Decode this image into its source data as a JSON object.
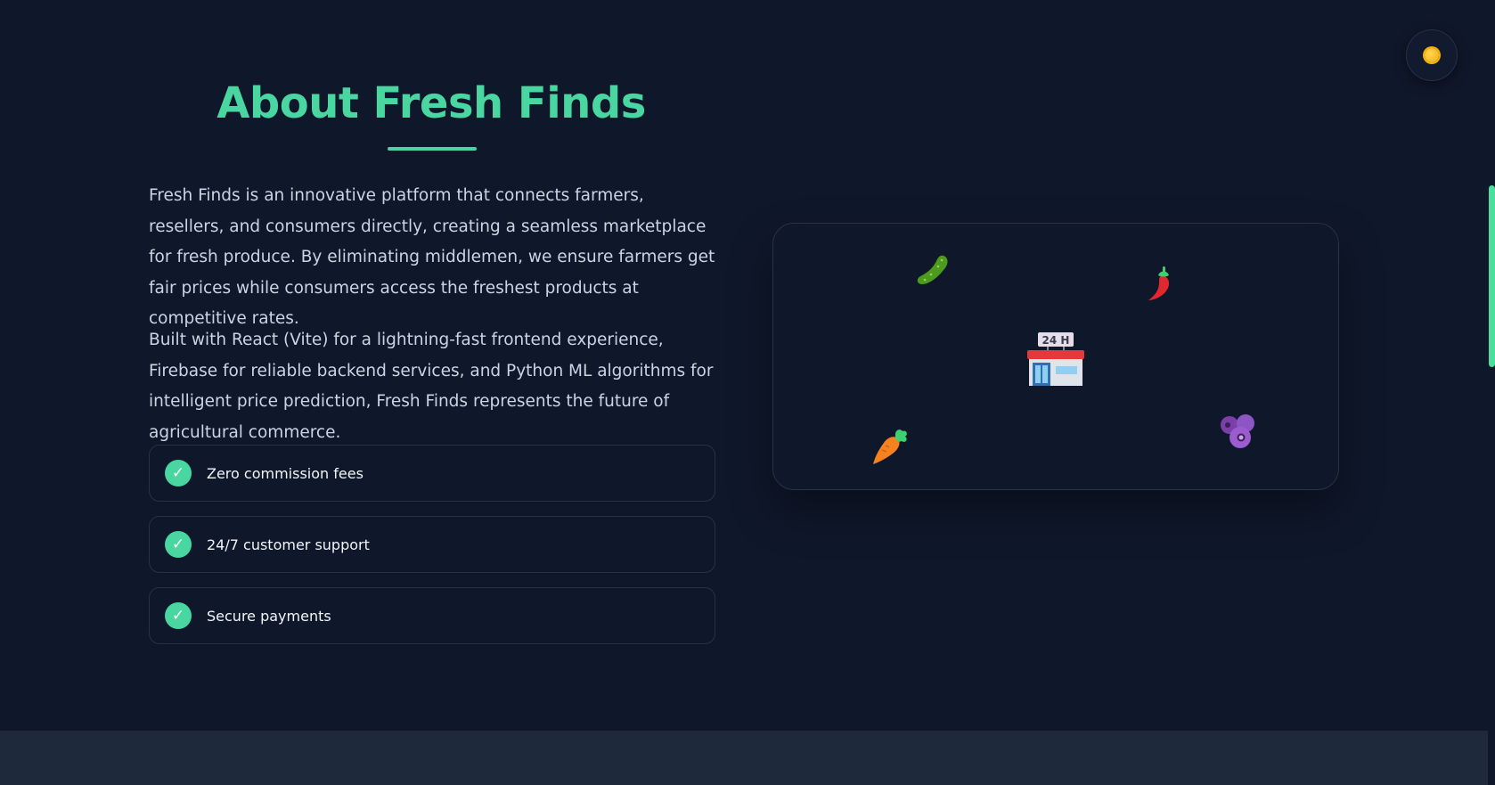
{
  "about": {
    "title": "About Fresh Finds",
    "paragraphs": [
      "Fresh Finds is an innovative platform that connects farmers, resellers, and consumers directly, creating a seamless marketplace for fresh produce. By eliminating middlemen, we ensure farmers get fair prices while consumers access the freshest products at competitive rates.",
      "Built with React (Vite) for a lightning-fast frontend experience, Firebase for reliable backend services, and Python ML algorithms for intelligent price prediction, Fresh Finds represents the future of agricultural commerce."
    ],
    "features": [
      {
        "label": "Zero commission fees",
        "icon": "check-icon"
      },
      {
        "label": "24/7 customer support",
        "icon": "check-icon"
      },
      {
        "label": "Secure payments",
        "icon": "check-icon"
      }
    ]
  },
  "showcase": {
    "store_sign": "24 H",
    "items": [
      "cucumber-icon",
      "chili-pepper-icon",
      "convenience-store-icon",
      "carrot-icon",
      "blueberries-icon"
    ]
  },
  "theme_toggle": {
    "icon": "sun-icon"
  },
  "colors": {
    "accent": "#4ad6a0",
    "background": "#0f172a",
    "footer": "#1e293b",
    "text": "#cbd5e1"
  }
}
